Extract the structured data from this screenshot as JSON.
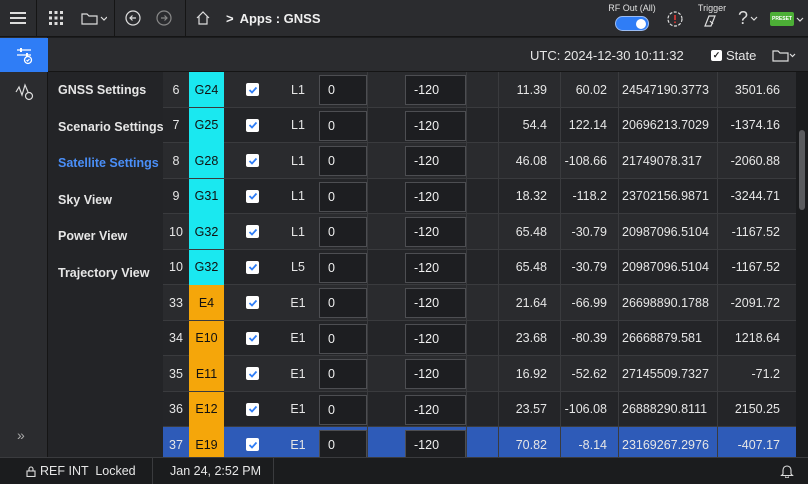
{
  "topbar": {
    "breadcrumb_sep": ">",
    "breadcrumb": "Apps : GNSS",
    "rf_out_label": "RF Out (All)",
    "trigger_label": "Trigger",
    "help_label": "?",
    "preset_label": "PRESET",
    "icons": [
      "hamburger-icon",
      "apps-grid-icon",
      "folder-icon",
      "back-icon",
      "forward-icon",
      "home-icon",
      "alert-icon",
      "trigger-icon",
      "help-icon"
    ]
  },
  "subbar": {
    "utc": "UTC: 2024-12-30 10:11:32",
    "state_label": "State",
    "state_checked": true
  },
  "rail": {
    "expand_label": "»"
  },
  "menu": {
    "items": [
      {
        "label": "GNSS Settings",
        "active": false
      },
      {
        "label": "Scenario Settings",
        "active": false
      },
      {
        "label": "Satellite Settings",
        "active": true
      },
      {
        "label": "Sky View",
        "active": false
      },
      {
        "label": "Power View",
        "active": false
      },
      {
        "label": "Trajectory View",
        "active": false
      }
    ]
  },
  "colors": {
    "gps": "#1ae8f0",
    "galileo": "#f5a60a",
    "accent": "#2f7df6",
    "selected_row": "#2e5bb8"
  },
  "rows": [
    {
      "idx": "6",
      "sat": "G24",
      "sys": "gps",
      "checked": true,
      "band": "L1",
      "val1": "0",
      "val2": "-120",
      "c1": "11.39",
      "c2": "60.02",
      "c3": "24547190.3773",
      "c4": "3501.66",
      "selected": false
    },
    {
      "idx": "7",
      "sat": "G25",
      "sys": "gps",
      "checked": true,
      "band": "L1",
      "val1": "0",
      "val2": "-120",
      "c1": "54.4",
      "c2": "122.14",
      "c3": "20696213.7029",
      "c4": "-1374.16",
      "selected": false
    },
    {
      "idx": "8",
      "sat": "G28",
      "sys": "gps",
      "checked": true,
      "band": "L1",
      "val1": "0",
      "val2": "-120",
      "c1": "46.08",
      "c2": "-108.66",
      "c3": "21749078.317",
      "c4": "-2060.88",
      "selected": false
    },
    {
      "idx": "9",
      "sat": "G31",
      "sys": "gps",
      "checked": true,
      "band": "L1",
      "val1": "0",
      "val2": "-120",
      "c1": "18.32",
      "c2": "-118.2",
      "c3": "23702156.9871",
      "c4": "-3244.71",
      "selected": false
    },
    {
      "idx": "10",
      "sat": "G32",
      "sys": "gps",
      "checked": true,
      "band": "L1",
      "val1": "0",
      "val2": "-120",
      "c1": "65.48",
      "c2": "-30.79",
      "c3": "20987096.5104",
      "c4": "-1167.52",
      "selected": false
    },
    {
      "idx": "10",
      "sat": "G32",
      "sys": "gps",
      "checked": true,
      "band": "L5",
      "val1": "0",
      "val2": "-120",
      "c1": "65.48",
      "c2": "-30.79",
      "c3": "20987096.5104",
      "c4": "-1167.52",
      "selected": false
    },
    {
      "idx": "33",
      "sat": "E4",
      "sys": "galileo",
      "checked": true,
      "band": "E1",
      "val1": "0",
      "val2": "-120",
      "c1": "21.64",
      "c2": "-66.99",
      "c3": "26698890.1788",
      "c4": "-2091.72",
      "selected": false
    },
    {
      "idx": "34",
      "sat": "E10",
      "sys": "galileo",
      "checked": true,
      "band": "E1",
      "val1": "0",
      "val2": "-120",
      "c1": "23.68",
      "c2": "-80.39",
      "c3": "26668879.581",
      "c4": "1218.64",
      "selected": false
    },
    {
      "idx": "35",
      "sat": "E11",
      "sys": "galileo",
      "checked": true,
      "band": "E1",
      "val1": "0",
      "val2": "-120",
      "c1": "16.92",
      "c2": "-52.62",
      "c3": "27145509.7327",
      "c4": "-71.2",
      "selected": false
    },
    {
      "idx": "36",
      "sat": "E12",
      "sys": "galileo",
      "checked": true,
      "band": "E1",
      "val1": "0",
      "val2": "-120",
      "c1": "23.57",
      "c2": "-106.08",
      "c3": "26888290.8111",
      "c4": "2150.25",
      "selected": false
    },
    {
      "idx": "37",
      "sat": "E19",
      "sys": "galileo",
      "checked": true,
      "band": "E1",
      "val1": "0",
      "val2": "-120",
      "c1": "70.82",
      "c2": "-8.14",
      "c3": "23169267.2976",
      "c4": "-407.17",
      "selected": true
    }
  ],
  "statusbar": {
    "ref": "REF INT  Locked",
    "datetime": "Jan 24, 2:52 PM"
  }
}
